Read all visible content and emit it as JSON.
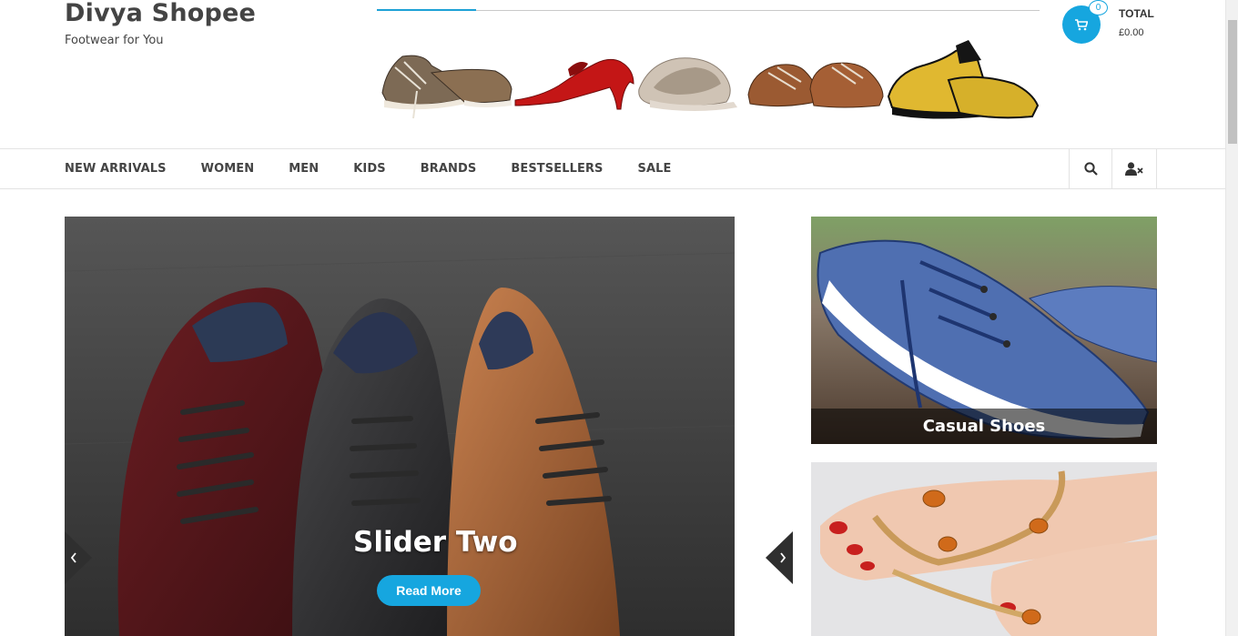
{
  "site": {
    "title": "Divya Shopee",
    "tagline": "Footwear for You"
  },
  "cart": {
    "count": "0",
    "total_label": "TOTAL",
    "total_value": "£0.00"
  },
  "nav": {
    "items": [
      "NEW ARRIVALS",
      "WOMEN",
      "MEN",
      "KIDS",
      "BRANDS",
      "BESTSELLERS",
      "SALE"
    ]
  },
  "slider": {
    "title": "Slider Two",
    "button": "Read More"
  },
  "promos": {
    "casual": "Casual Shoes"
  },
  "colors": {
    "accent": "#16a6df",
    "text": "#444444"
  }
}
